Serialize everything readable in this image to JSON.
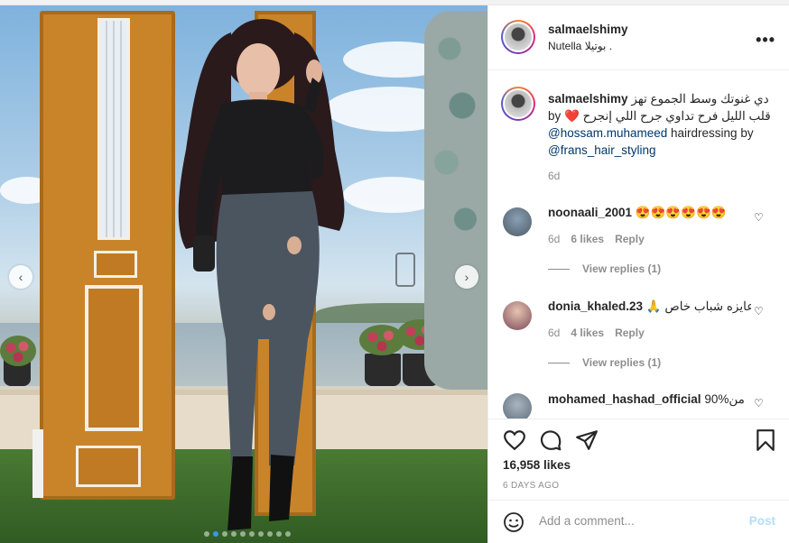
{
  "post": {
    "username": "salmaelshimy",
    "location": "Nutella بوتيلا .",
    "caption": {
      "text_arabic": "دي غنوتك وسط الجموع تهز قلب الليل فرح تداوي جرح اللي إنجرح ❤️ by",
      "mention1": "@hossam.muhameed",
      "mid": "hairdressing by",
      "mention2": "@frans_hair_styling",
      "time": "6d"
    },
    "likes": "16,958 likes",
    "date": "6 DAYS AGO"
  },
  "comments": [
    {
      "username": "noonaali_2001",
      "text": "😍😍😍😍😍😍",
      "time": "6d",
      "likes": "6 likes",
      "reply": "Reply",
      "view_replies": "View replies (1)"
    },
    {
      "username": "donia_khaled.23",
      "text": "عايزه شباب خاص 🙏",
      "time": "6d",
      "likes": "4 likes",
      "reply": "Reply",
      "view_replies": "View replies (1)"
    },
    {
      "username": "mohamed_hashad_official",
      "text": "90%من"
    }
  ],
  "add_comment": {
    "placeholder": "Add a comment...",
    "post_label": "Post"
  },
  "carousel": {
    "total_slides": 10,
    "active_index": 1
  },
  "colors": {
    "accent": "#3897f0",
    "link": "#00376b",
    "muted": "#8e8e8e",
    "post_disabled": "#b2dffc"
  },
  "icons": {
    "more": "more-options-icon",
    "heart": "heart-icon",
    "comment": "comment-icon",
    "share": "share-icon",
    "save": "bookmark-icon",
    "emoji": "emoji-icon"
  }
}
